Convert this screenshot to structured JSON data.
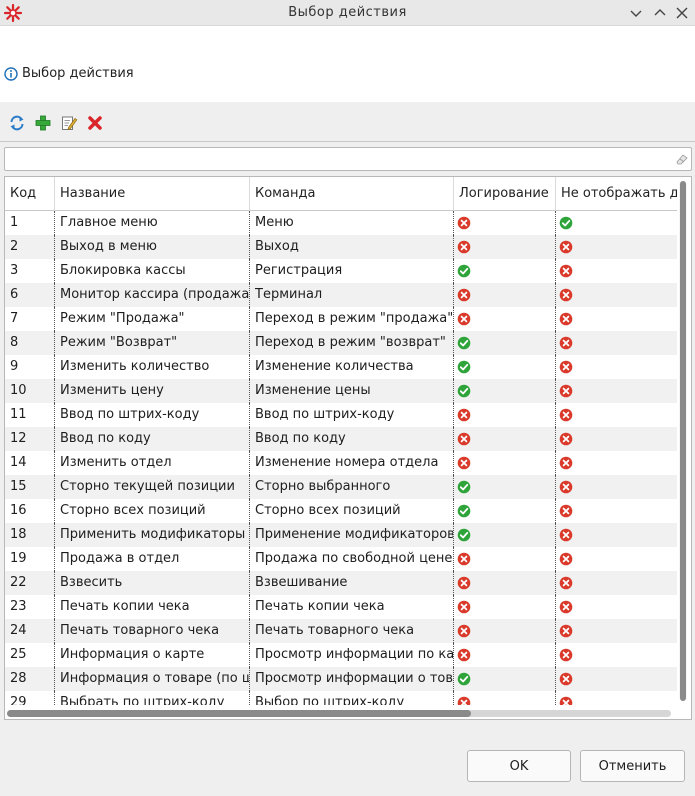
{
  "window": {
    "title": "Выбор  действия"
  },
  "header": {
    "info_text": "Выбор действия"
  },
  "toolbar": [
    "refresh-icon",
    "add-icon",
    "edit-icon",
    "delete-icon"
  ],
  "filter": {
    "value": "",
    "placeholder": ""
  },
  "table": {
    "columns": [
      "Код",
      "Название",
      "Команда",
      "Логирование",
      "Не отображать де"
    ],
    "rows": [
      {
        "code": "1",
        "name": "Главное меню",
        "command": "Меню",
        "log": false,
        "hide": true
      },
      {
        "code": "2",
        "name": "Выход в меню",
        "command": "Выход",
        "log": false,
        "hide": false
      },
      {
        "code": "3",
        "name": "Блокировка кассы",
        "command": "Регистрация",
        "log": true,
        "hide": false
      },
      {
        "code": "6",
        "name": "Монитор кассира (продажа)",
        "command": "Терминал",
        "log": false,
        "hide": false
      },
      {
        "code": "7",
        "name": "Режим \"Продажа\"",
        "command": "Переход в режим \"продажа\"",
        "log": false,
        "hide": false
      },
      {
        "code": "8",
        "name": "Режим \"Возврат\"",
        "command": "Переход в режим \"возврат\"",
        "log": true,
        "hide": false
      },
      {
        "code": "9",
        "name": "Изменить количество",
        "command": "Изменение количества",
        "log": true,
        "hide": false
      },
      {
        "code": "10",
        "name": "Изменить цену",
        "command": "Изменение цены",
        "log": true,
        "hide": false
      },
      {
        "code": "11",
        "name": "Ввод по штрих-коду",
        "command": "Ввод по штрих-коду",
        "log": false,
        "hide": false
      },
      {
        "code": "12",
        "name": "Ввод по коду",
        "command": "Ввод по коду",
        "log": false,
        "hide": false
      },
      {
        "code": "14",
        "name": "Изменить отдел",
        "command": "Изменение номера отдела",
        "log": false,
        "hide": false
      },
      {
        "code": "15",
        "name": "Сторно текущей позиции",
        "command": "Сторно выбранного",
        "log": true,
        "hide": false
      },
      {
        "code": "16",
        "name": "Сторно всех позиций",
        "command": "Сторно всех позиций",
        "log": true,
        "hide": false
      },
      {
        "code": "18",
        "name": "Применить модификаторы к",
        "command": "Применение модификаторов",
        "log": true,
        "hide": false
      },
      {
        "code": "19",
        "name": "Продажа в отдел",
        "command": "Продажа по свободной цене",
        "log": false,
        "hide": false
      },
      {
        "code": "22",
        "name": "Взвесить",
        "command": "Взвешивание",
        "log": false,
        "hide": false
      },
      {
        "code": "23",
        "name": "Печать копии чека",
        "command": "Печать копии чека",
        "log": false,
        "hide": false
      },
      {
        "code": "24",
        "name": "Печать товарного чека",
        "command": "Печать товарного чека",
        "log": false,
        "hide": false
      },
      {
        "code": "25",
        "name": "Информация о карте",
        "command": "Просмотр информации по карте",
        "log": false,
        "hide": false
      },
      {
        "code": "28",
        "name": "Информация о товаре (по шт",
        "command": "Просмотр информации о товаре",
        "log": true,
        "hide": false
      },
      {
        "code": "29",
        "name": "Выбрать по штрих-коду",
        "command": "Выбор по штрих-коду",
        "log": false,
        "hide": false
      }
    ]
  },
  "buttons": {
    "ok": "OK",
    "cancel": "Отменить"
  },
  "colors": {
    "ok_green": "#2ea43a",
    "error_red": "#d93a2b",
    "accent_blue": "#1d6fb8"
  }
}
